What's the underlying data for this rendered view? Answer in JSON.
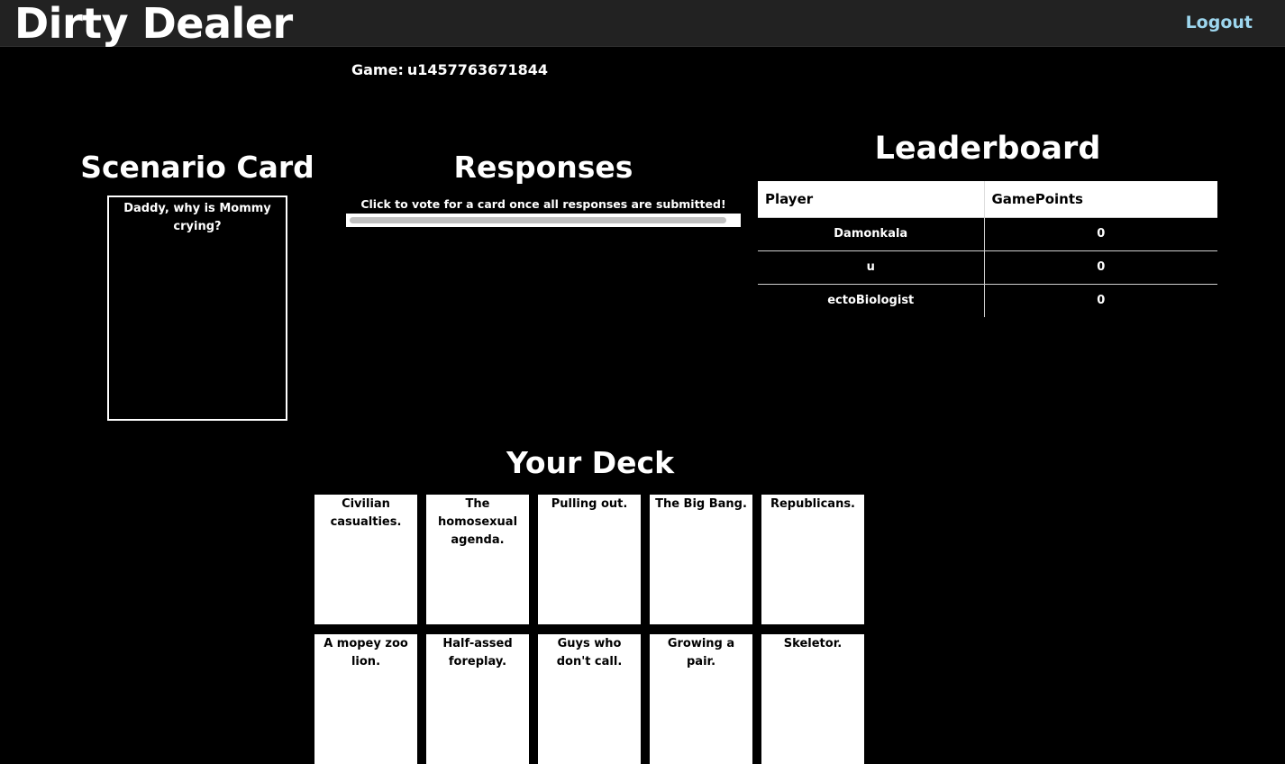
{
  "navbar": {
    "brand": "Dirty Dealer",
    "logout_label": "Logout"
  },
  "game": {
    "label": "Game:",
    "id": "u1457763671844"
  },
  "scenario": {
    "title": "Scenario Card",
    "card_text": "Daddy, why is Mommy crying?"
  },
  "responses": {
    "title": "Responses",
    "hint": "Click to vote for a card once all responses are submitted!"
  },
  "leaderboard": {
    "title": "Leaderboard",
    "columns": [
      "Player",
      "GamePoints"
    ],
    "rows": [
      {
        "player": "Damonkala",
        "points": "0"
      },
      {
        "player": "u",
        "points": "0"
      },
      {
        "player": "ectoBiologist",
        "points": "0"
      }
    ]
  },
  "deck": {
    "title": "Your Deck",
    "cards": [
      "Civilian casualties.",
      "The homosexual agenda.",
      "Pulling out.",
      "The Big Bang.",
      "Republicans.",
      "A mopey zoo lion.",
      "Half-assed foreplay.",
      "Guys who don't call.",
      "Growing a pair.",
      "Skeletor."
    ]
  },
  "colors": {
    "background": "#000000",
    "navbar": "#222222",
    "logout_link": "#9dd6ee",
    "card": "#ffffff"
  }
}
